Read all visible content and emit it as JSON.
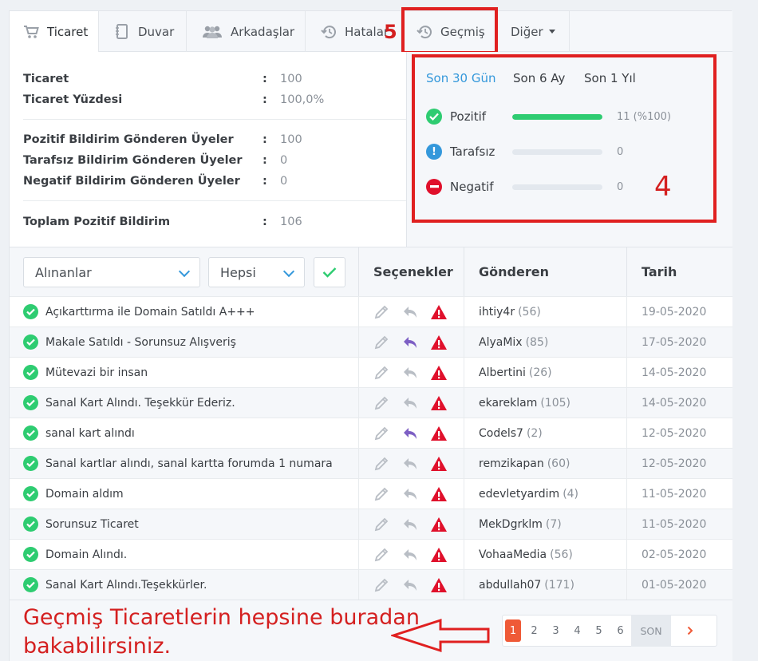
{
  "tabs": [
    {
      "label": "Ticaret",
      "icon": "cart-icon"
    },
    {
      "label": "Duvar",
      "icon": "notebook-icon"
    },
    {
      "label": "Arkadaşlar",
      "icon": "users-icon"
    },
    {
      "label": "Hatalar",
      "icon": "history-icon"
    },
    {
      "label": "Geçmiş",
      "icon": "history-icon"
    },
    {
      "label": "Diğer",
      "icon": "chevron-down-icon"
    }
  ],
  "stats": [
    {
      "label": "Ticaret",
      "value": "100"
    },
    {
      "label": "Ticaret Yüzdesi",
      "value": "100,0%"
    },
    {
      "label": "Pozitif Bildirim Gönderen Üyeler",
      "value": "100"
    },
    {
      "label": "Tarafsız Bildirim Gönderen Üyeler",
      "value": "0"
    },
    {
      "label": "Negatif Bildirim Gönderen Üyeler",
      "value": "0"
    },
    {
      "label": "Toplam Pozitif Bildirim",
      "value": "106"
    }
  ],
  "colon": ":",
  "periods": [
    "Son 30 Gün",
    "Son 6 Ay",
    "Son 1 Yıl"
  ],
  "feedback": [
    {
      "label": "Pozitif",
      "value": "11 (%100)",
      "fraction": 1.0,
      "color": "#2ecc71"
    },
    {
      "label": "Tarafsız",
      "value": "0",
      "fraction": 0,
      "color": "#3498db"
    },
    {
      "label": "Negatif",
      "value": "0",
      "fraction": 0,
      "color": "#e0102b"
    }
  ],
  "annotations": {
    "tab_number": "5",
    "box_number": "4",
    "footer_text_1": "Geçmiş Ticaretlerin hepsine buradan",
    "footer_text_2": "bakabilirsiniz."
  },
  "filters": {
    "type": "Alınanlar",
    "scope": "Hepsi"
  },
  "columns": [
    "Seçenekler",
    "Gönderen",
    "Tarih"
  ],
  "rows": [
    {
      "title": "Açıkarttırma ile Domain Satıldı A+++",
      "sender": "ihtiy4r",
      "score": "(56)",
      "date": "19-05-2020",
      "replied": false
    },
    {
      "title": "Makale Satıldı - Sorunsuz Alışveriş",
      "sender": "AlyaMix",
      "score": "(85)",
      "date": "17-05-2020",
      "replied": true
    },
    {
      "title": "Mütevazi bir insan",
      "sender": "Albertini",
      "score": "(26)",
      "date": "14-05-2020",
      "replied": false
    },
    {
      "title": "Sanal Kart Alındı. Teşekkür Ederiz.",
      "sender": "ekareklam",
      "score": "(105)",
      "date": "14-05-2020",
      "replied": false
    },
    {
      "title": "sanal kart alındı",
      "sender": "Codels7",
      "score": "(2)",
      "date": "12-05-2020",
      "replied": true
    },
    {
      "title": "Sanal kartlar alındı, sanal kartta forumda 1 numara",
      "sender": "remzikapan",
      "score": "(60)",
      "date": "12-05-2020",
      "replied": false
    },
    {
      "title": "Domain aldım",
      "sender": "edevletyardim",
      "score": "(4)",
      "date": "11-05-2020",
      "replied": false
    },
    {
      "title": "Sorunsuz Ticaret",
      "sender": "MekDgrklm",
      "score": "(7)",
      "date": "11-05-2020",
      "replied": false
    },
    {
      "title": "Domain Alındı.",
      "sender": "VohaaMedia",
      "score": "(56)",
      "date": "02-05-2020",
      "replied": false
    },
    {
      "title": "Sanal Kart Alındı.Teşekkürler.",
      "sender": "abdullah07",
      "score": "(171)",
      "date": "01-05-2020",
      "replied": false
    }
  ],
  "pagination": {
    "pages": [
      "1",
      "2",
      "3",
      "4",
      "5",
      "6"
    ],
    "current": "1",
    "last_label": "SON"
  },
  "colors": {
    "accent": "#3498db",
    "positive": "#2ecc71",
    "danger": "#e0102b",
    "reply": "#7d5fc4",
    "annotation": "#e02020"
  }
}
